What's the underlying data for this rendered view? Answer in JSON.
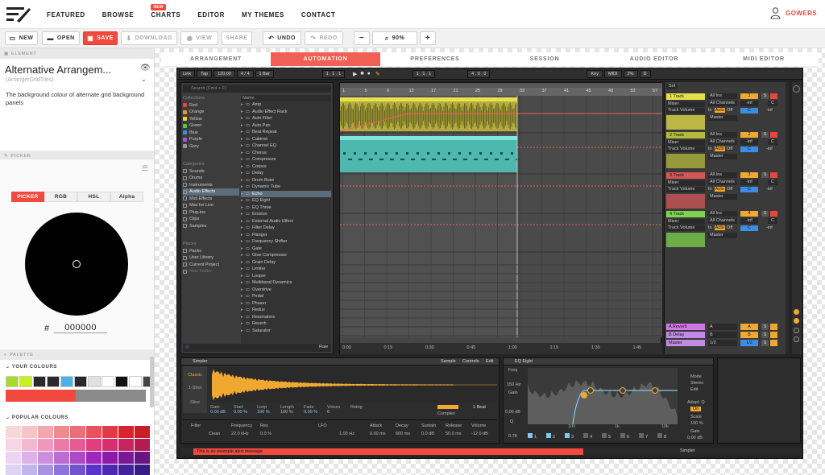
{
  "nav": {
    "links": [
      "FEATURED",
      "BROWSE",
      "CHARTS",
      "EDITOR",
      "MY THEMES",
      "CONTACT"
    ],
    "new_badge": "NEW",
    "user": "GOWERS"
  },
  "toolbar": {
    "new": "NEW",
    "open": "OPEN",
    "save": "SAVE",
    "download": "DOWNLOAD",
    "view": "VIEW",
    "share": "SHARE",
    "undo": "UNDO",
    "redo": "REDO",
    "minus": "−",
    "zoom": "90%",
    "plus": "+"
  },
  "element": {
    "section": "ELEMENT",
    "title": "Alternative Arrangem...",
    "subtitle": "(ArrangerGridTiles)",
    "description": "The background colour of alternate grid background panels"
  },
  "picker": {
    "section": "PICKER",
    "tabs": [
      "PICKER",
      "RGB",
      "HSL",
      "Alpha"
    ],
    "hash": "#",
    "hex": "000000"
  },
  "palette": {
    "section": "PALETTE",
    "your_colours": "YOUR COLOURS",
    "your_swatches": [
      "#a6dc29",
      "#c9f01c",
      "#2a2a2a",
      "#2a2a2a",
      "#4ab0e8",
      "#2a2a2a",
      "#e0e0e0",
      "#ffffff",
      "#111111",
      "#ffffff",
      "#444444"
    ],
    "bar_colors": [
      "#f2493e",
      "#8a8a8a"
    ],
    "popular_colours": "POPULAR COLOURS",
    "popular_swatches": [
      "#f8d7da",
      "#f6c3c7",
      "#f2a7ae",
      "#ee8b92",
      "#ea6f78",
      "#e6535d",
      "#e23a44",
      "#d9242f",
      "#c81e28",
      "#f9d4e4",
      "#f5b6d0",
      "#f098bb",
      "#eb7aa6",
      "#e65c92",
      "#e13e7d",
      "#d92e6e",
      "#c9245f",
      "#b51b51",
      "#ecd4f3",
      "#dcb2e8",
      "#cc8fdd",
      "#bc6dd2",
      "#ac4ac7",
      "#9c28bc",
      "#8c1ca8",
      "#7a1896",
      "#6a1484",
      "#dcd4f5",
      "#c2b4ec",
      "#a893e3",
      "#8e73da",
      "#7453d1",
      "#5a33c8",
      "#4d28b2",
      "#42229c",
      "#371c86"
    ]
  },
  "tabs": [
    "ARRANGEMENT",
    "AUTOMATION",
    "PREFERENCES",
    "SESSION",
    "AUDIO EDITOR",
    "MIDI EDITOR"
  ],
  "daw": {
    "top": {
      "link": "Link",
      "tap": "Tap",
      "bpm": "120.00",
      "sig": "4 / 4",
      "bar": "1 Bar",
      "pos": "1 . 1 . 1",
      "loop": "1 . 1 . 1",
      "len": "4 . 0 . 0",
      "key": "Key",
      "midi": "MIDI",
      "cpu": "2%",
      "d": "D"
    },
    "search": "Search (Cmd + F)",
    "collections_head": "Collections",
    "collections": [
      {
        "name": "Red",
        "color": "#e8453c"
      },
      {
        "name": "Orange",
        "color": "#f0932b"
      },
      {
        "name": "Yellow",
        "color": "#f1d41c"
      },
      {
        "name": "Green",
        "color": "#59c945"
      },
      {
        "name": "Blue",
        "color": "#3a8ee6"
      },
      {
        "name": "Purple",
        "color": "#a454e0"
      },
      {
        "name": "Grey",
        "color": "#999999"
      }
    ],
    "categories_head": "Categories",
    "categories": [
      "Sounds",
      "Drums",
      "Instruments",
      "Audio Effects",
      "Midi Effects",
      "Max for Live",
      "Plug-ins",
      "Clips",
      "Samples"
    ],
    "places_head": "Places",
    "places": [
      "Packs",
      "User Library",
      "Current Project",
      "New Folder"
    ],
    "name_head": "Name",
    "items": [
      "Amp",
      "Audio Effect Rack",
      "Auto Filter",
      "Auto Pan",
      "Beat Repeat",
      "Cabinet",
      "Channel EQ",
      "Chorus",
      "Compressor",
      "Corpus",
      "Delay",
      "Drum Buss",
      "Dynamic Tube",
      "Echo",
      "EQ Eight",
      "EQ Three",
      "Erosion",
      "External Audio Effect",
      "Filter Delay",
      "Flanger",
      "Frequency Shifter",
      "Gate",
      "Glue Compressor",
      "Grain Delay",
      "Limiter",
      "Looper",
      "Multiband Dynamics",
      "Overdrive",
      "Pedal",
      "Phaser",
      "Redux",
      "Resonators",
      "Reverb",
      "Saturator"
    ],
    "selected_item": "Echo",
    "raw": "Raw",
    "ruler": [
      "1",
      "5",
      "9",
      "13",
      "17",
      "21",
      "25",
      "29",
      "33",
      "37",
      "41",
      "45",
      "49",
      "53",
      "57"
    ],
    "time": [
      "0:00",
      "0:15",
      "0:30",
      "0:45",
      "1:00",
      "1:15",
      "1:30",
      "1:45"
    ],
    "set": "Set",
    "tracks": [
      {
        "name": "1 Track",
        "color": "#e8e04a",
        "in": "All Ins",
        "ch": "All Channels",
        "vol": "Track Volume",
        "mix": "Mixer",
        "out": "Master",
        "num": "1"
      },
      {
        "name": "2 Track",
        "color": "#b4b93a",
        "in": "All Ins",
        "ch": "All Channels",
        "vol": "Track Volume",
        "mix": "Mixer",
        "out": "Master",
        "num": "2"
      },
      {
        "name": "3 Track",
        "color": "#d45757",
        "in": "All Ins",
        "ch": "All Channels",
        "vol": "Track Volume",
        "mix": "Mixer",
        "out": "Master",
        "num": "3"
      },
      {
        "name": "4 Track",
        "color": "#7fd44e",
        "in": "All Ins",
        "ch": "All Channels",
        "vol": "Track Volume",
        "mix": "Mixer",
        "out": "Master",
        "num": "4"
      }
    ],
    "io": {
      "in": "In",
      "auto": "Auto",
      "off": "Off",
      "inf": "-inf",
      "c": "C",
      "s": "S"
    },
    "returns": [
      {
        "name": "A Reverb",
        "label": "A"
      },
      {
        "name": "B Delay",
        "label": "B"
      },
      {
        "name": "Master",
        "label": "1/2"
      }
    ],
    "simpler": {
      "title": "Simpler",
      "mode": "Classic",
      "shot": "1-Shot",
      "slice": "Slice",
      "sample": "Sample",
      "controls": "Controls",
      "edit": "Edit",
      "params": [
        "Gain",
        "Start",
        "Loop",
        "Length",
        "Fade",
        "Voices",
        "Retrig"
      ],
      "values": [
        "0.00 dB",
        "0.00 %",
        "100 %",
        "100 %",
        "0.00 %",
        "6"
      ],
      "filter": "Filter",
      "freq": "Frequency",
      "freq_val": "22.0 kHz",
      "res": "Res",
      "res_val": "0.0 %",
      "lfo": "LFO",
      "lfo_val": "1.00 Hz",
      "attack": "Attack",
      "attack_val": "0.00 ms",
      "decay": "Decay",
      "decay_val": "600 ms",
      "sustain": "Sustain",
      "sustain_val": "0.0 dB",
      "release": "Release",
      "release_val": "50.0 ms",
      "volume": "Volume",
      "volume_val": "-12.0 dB",
      "complex": "Complex",
      "beat": "1 Beat",
      "clean": "Clean"
    },
    "eq": {
      "title": "EQ Eight",
      "freq": "Freq",
      "freq_val": "150 Hz",
      "gain": "Gain",
      "gain_val": "0.00 dB",
      "q": "Q",
      "q_val": "0.78",
      "mode": "Mode",
      "stereo": "Stereo",
      "edit": "Edit",
      "adapt": "Adapt. Q",
      "on": "On",
      "scale": "Scale",
      "scale_val": "100 %",
      "gain2": "Gain",
      "gain2_val": "0.00 dB",
      "axis": [
        "100",
        "1k",
        "10k"
      ],
      "bands": [
        "1",
        "2",
        "3",
        "4",
        "5",
        "6",
        "7",
        "8"
      ]
    },
    "alert": "This is an example alert message",
    "status_right": "Simpler"
  }
}
